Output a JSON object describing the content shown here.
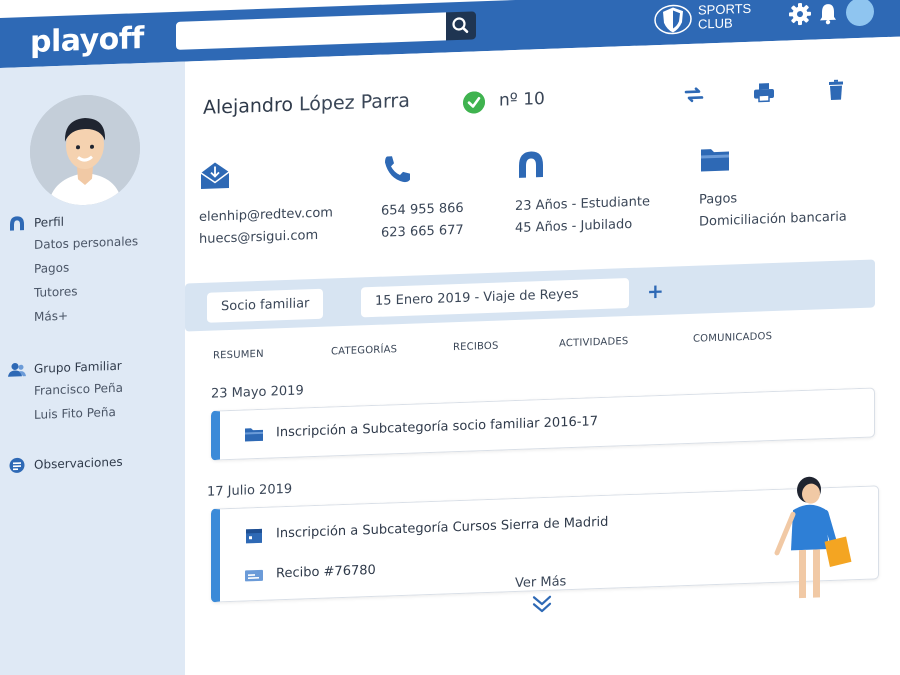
{
  "app": {
    "logo": "playoff",
    "search_placeholder": "",
    "club_line1": "SPORTS",
    "club_line2": "CLUB"
  },
  "sidebar": {
    "groups": [
      {
        "label": "Perfil",
        "items": [
          "Datos personales",
          "Pagos",
          "Tutores",
          "Más+"
        ]
      },
      {
        "label": "Grupo Familiar",
        "items": [
          "Francisco Peña",
          "Luis Fito Peña"
        ]
      },
      {
        "label": "Observaciones",
        "items": []
      }
    ]
  },
  "profile": {
    "first_name": "Alejandro",
    "last_name": " López Parra",
    "member_number": "nº 10",
    "columns": [
      {
        "icon": "email-icon",
        "lines": [
          "elenhip@redtev.com",
          "huecs@rsigui.com"
        ]
      },
      {
        "icon": "phone-icon",
        "lines": [
          "654 955 866",
          "623 665 677"
        ]
      },
      {
        "icon": "person-icon",
        "lines": [
          "23 Años - Estudiante",
          "45 Años - Jubilado"
        ]
      },
      {
        "icon": "folder-icon",
        "lines": [
          "Pagos",
          "Domiciliación bancaria"
        ]
      }
    ]
  },
  "family_bar": {
    "chip1": "Socio familiar",
    "chip2": "15 Enero 2019 - Viaje de Reyes",
    "add": "+"
  },
  "tabs": [
    "RESUMEN",
    "CATEGORÍAS",
    "RECIBOS",
    "ACTIVIDADES",
    "COMUNICADOS"
  ],
  "timeline": [
    {
      "date": "23 Mayo 2019",
      "entries": [
        {
          "icon": "folder-icon",
          "text": "Inscripción a Subcategoría socio familiar 2016-17"
        }
      ]
    },
    {
      "date": "17 Julio 2019",
      "entries": [
        {
          "icon": "calendar-icon",
          "text": "Inscripción a Subcategoría Cursos Sierra de Madrid"
        },
        {
          "icon": "receipt-icon",
          "text": "Recibo #76780"
        }
      ]
    }
  ],
  "more": "Ver Más",
  "colors": {
    "brand": "#2e69b5",
    "accent": "#3b8ad8",
    "sidebar": "#dfe9f5",
    "success": "#3fb34f"
  }
}
